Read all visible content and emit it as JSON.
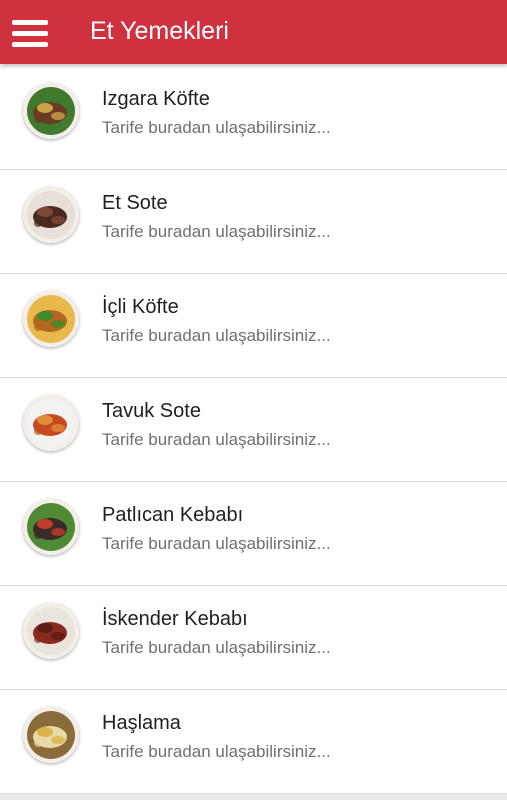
{
  "appbar": {
    "title": "Et Yemekleri",
    "menu_icon": "hamburger-menu-icon",
    "color": "#d0313e"
  },
  "recipes": [
    {
      "name": "Izgara Köfte",
      "subtitle": "Tarife buradan ulaşabilirsiniz...",
      "thumb_colors": [
        "#6b3a22",
        "#c9a24a",
        "#3f7a2f"
      ]
    },
    {
      "name": "Et Sote",
      "subtitle": "Tarife buradan ulaşabilirsiniz...",
      "thumb_colors": [
        "#4a2a1e",
        "#7a4a34",
        "#e8e0d8"
      ]
    },
    {
      "name": "İçli Köfte",
      "subtitle": "Tarife buradan ulaşabilirsiniz...",
      "thumb_colors": [
        "#b5671f",
        "#3f8a2a",
        "#e7b84a"
      ]
    },
    {
      "name": "Tavuk Sote",
      "subtitle": "Tarife buradan ulaşabilirsiniz...",
      "thumb_colors": [
        "#c74a1f",
        "#e08a3a",
        "#f2f2f2"
      ]
    },
    {
      "name": "Patlıcan Kebabı",
      "subtitle": "Tarife buradan ulaşabilirsiniz...",
      "thumb_colors": [
        "#3a2a2a",
        "#c23b2b",
        "#4f8a34"
      ]
    },
    {
      "name": "İskender Kebabı",
      "subtitle": "Tarife buradan ulaşabilirsiniz...",
      "thumb_colors": [
        "#8a2a1e",
        "#5a1e14",
        "#e9e4dc"
      ]
    },
    {
      "name": "Haşlama",
      "subtitle": "Tarife buradan ulaşabilirsiniz...",
      "thumb_colors": [
        "#e8d9a6",
        "#d9b24a",
        "#8a6b3a"
      ]
    }
  ]
}
